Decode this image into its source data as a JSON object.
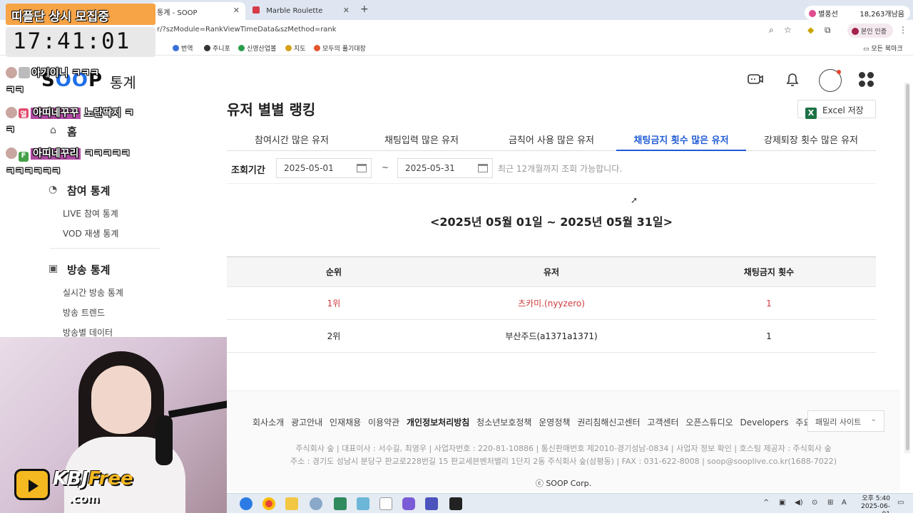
{
  "browser": {
    "tabs": [
      {
        "label": "통계 - SOOP"
      },
      {
        "label": "Marble Roulette"
      }
    ],
    "new_tab": "+",
    "url": "r/?szModule=RankViewTimeData&szMethod=rank",
    "profile_name": "별풍선",
    "profile_count": "18,263개남음",
    "verify_label": "본인 인증",
    "bookmarks": [
      {
        "label": "번역",
        "color": "#3b6fd8"
      },
      {
        "label": "주니포",
        "color": "#333333"
      },
      {
        "label": "신영산업볼",
        "color": "#2a9d4a"
      },
      {
        "label": "지도",
        "color": "#d4a21c"
      },
      {
        "label": "모두의 풀기대장",
        "color": "#e4562d"
      }
    ],
    "all_bookmarks": "모든 북마크"
  },
  "overlay": {
    "banner": "띠플단 상시 모집중",
    "clock": "17:41:01",
    "chat": [
      {
        "nick": "아기이니",
        "msg": "ㅋㅋㅋ",
        "cont": "ㅋㅋ"
      },
      {
        "badge": "열",
        "badge_color": "#e04c6c",
        "nick": "아띠네꾸꾸",
        "msg": " 노란딱지 ㅋ",
        "cont": "ㅋ"
      },
      {
        "badge": "F",
        "badge_color": "#46a04a",
        "nick": "아띠네꾸리",
        "msg": " ㅋㅋㅋㅋㅋ",
        "cont": "ㅋㅋㅋㅋㅋㅋ"
      }
    ],
    "kbj_brand": "KBJ",
    "kbj_free": "Free",
    "kbj_com": ".com"
  },
  "site": {
    "logo_left": "S",
    "logo_o": "OO",
    "logo_right": "P",
    "logo_sub": "통계"
  },
  "nav": {
    "home": "홈",
    "sections": [
      {
        "title": "참여 통계",
        "items": [
          "LIVE 참여 통계",
          "VOD 재생 통계"
        ]
      },
      {
        "title": "방송 통계",
        "items": [
          "실시간 방송 통계",
          "방송 트렌드",
          "방송별 데이터"
        ]
      }
    ]
  },
  "main": {
    "title": "유저 별별 랭킹",
    "excel_label": "Excel 저장",
    "tabs": [
      "참여시간 많은 유저",
      "채팅입력 많은 유저",
      "금칙어 사용 많은 유저",
      "채팅금지 횟수 많은 유저",
      "강제퇴장 횟수 많은 유저"
    ],
    "active_tab": 3,
    "filter_label": "조회기간",
    "date_from": "2025-05-01",
    "date_to": "2025-05-31",
    "tilde": "~",
    "filter_note": "최근 12개월까지 조회 가능합니다.",
    "period": "<2025년 05월 01일 ~ 2025년 05월 31일>",
    "table": {
      "headers": [
        "순위",
        "유저",
        "채팅금지 횟수"
      ],
      "rows": [
        {
          "rank": "1위",
          "user": "츠카미.(nyyzero)",
          "count": "1",
          "highlight": true
        },
        {
          "rank": "2위",
          "user": "부산주드(a1371a1371)",
          "count": "1",
          "highlight": false
        }
      ]
    }
  },
  "footer": {
    "links": [
      "회사소개",
      "광고안내",
      "인재채용",
      "이용약관",
      "개인정보처리방침",
      "청소년보호정책",
      "운영정책",
      "권리침해신고센터",
      "고객센터",
      "오픈스튜디오",
      "Developers",
      "주요서비스"
    ],
    "bold_link": "개인정보처리방침",
    "family_site": "패밀리 사이트",
    "line1": "주식회사 숲  |  대표이사 : 서수길, 최영우  |  사업자번호 : 220-81-10886  |  통신판매번호 제2010-경기성남-0834  |  사업자 정보 확인  |  호스팅 제공자 : 주식회사 숲",
    "line2": "주소 : 경기도 성남시 분당구 판교로228번길 15 판교세븐벤처밸리 1단지 2동 주식회사 숲(삼평동)  |  FAX : 031-622-8008  |  soop@sooplive.co.kr(1688-7022)",
    "copyright": "ⓒ SOOP Corp."
  },
  "taskbar": {
    "time": "오후 5:40",
    "date": "2025-06-01"
  }
}
